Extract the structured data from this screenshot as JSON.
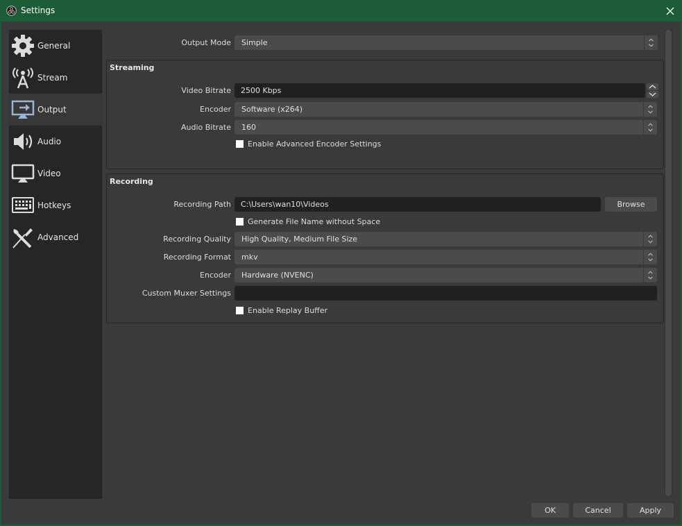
{
  "window": {
    "title": "Settings"
  },
  "sidebar": {
    "items": [
      {
        "label": "General",
        "icon": "gear-icon"
      },
      {
        "label": "Stream",
        "icon": "antenna-icon"
      },
      {
        "label": "Output",
        "icon": "output-monitor-icon",
        "active": true
      },
      {
        "label": "Audio",
        "icon": "speaker-icon"
      },
      {
        "label": "Video",
        "icon": "monitor-icon"
      },
      {
        "label": "Hotkeys",
        "icon": "keyboard-icon"
      },
      {
        "label": "Advanced",
        "icon": "tools-icon"
      }
    ]
  },
  "output": {
    "mode_label": "Output Mode",
    "mode_value": "Simple",
    "streaming": {
      "title": "Streaming",
      "video_bitrate_label": "Video Bitrate",
      "video_bitrate_value": "2500 Kbps",
      "encoder_label": "Encoder",
      "encoder_value": "Software (x264)",
      "audio_bitrate_label": "Audio Bitrate",
      "audio_bitrate_value": "160",
      "advanced_encoder_label": "Enable Advanced Encoder Settings",
      "advanced_encoder_checked": false
    },
    "recording": {
      "title": "Recording",
      "path_label": "Recording Path",
      "path_value": "C:\\Users\\wan10\\Videos",
      "browse_label": "Browse",
      "no_space_label": "Generate File Name without Space",
      "no_space_checked": false,
      "quality_label": "Recording Quality",
      "quality_value": "High Quality, Medium File Size",
      "format_label": "Recording Format",
      "format_value": "mkv",
      "encoder_label": "Encoder",
      "encoder_value": "Hardware (NVENC)",
      "muxer_label": "Custom Muxer Settings",
      "muxer_value": "",
      "replay_label": "Enable Replay Buffer",
      "replay_checked": false
    }
  },
  "footer": {
    "ok": "OK",
    "cancel": "Cancel",
    "apply": "Apply"
  },
  "colors": {
    "titlebar": "#1d5c38",
    "background": "#3a3a3a",
    "sidebar": "#262626",
    "accent_icon": "#9ab6d6"
  }
}
